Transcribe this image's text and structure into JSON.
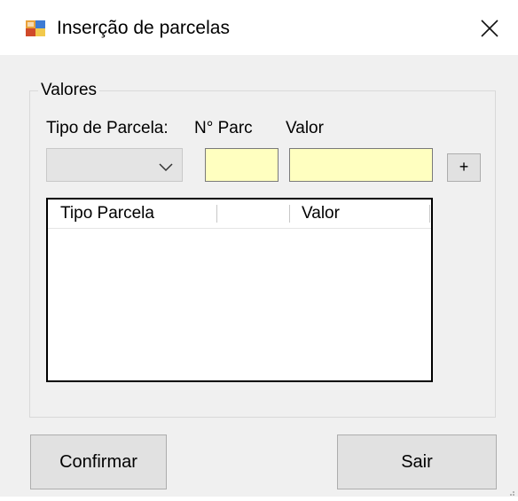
{
  "window": {
    "title": "Inserção de parcelas",
    "app_icon": "form-window-icon",
    "close_icon": "close-icon"
  },
  "group": {
    "caption": "Valores",
    "labels": {
      "tipo_parcela": "Tipo de Parcela:",
      "num_parc": "N° Parc",
      "valor": "Valor"
    },
    "tipo_parcela_combo": {
      "value": "",
      "icon": "chevron-down-icon"
    },
    "num_parc_input": {
      "value": ""
    },
    "valor_input": {
      "value": ""
    },
    "add_button": {
      "label": "+"
    },
    "listview": {
      "columns": [
        "Tipo Parcela",
        "",
        "Valor"
      ],
      "rows": []
    }
  },
  "buttons": {
    "confirm": "Confirmar",
    "exit": "Sair"
  },
  "colors": {
    "input_yellow": "#ffffc0",
    "form_bg": "#f0f0f0",
    "button_bg": "#e1e1e1"
  }
}
